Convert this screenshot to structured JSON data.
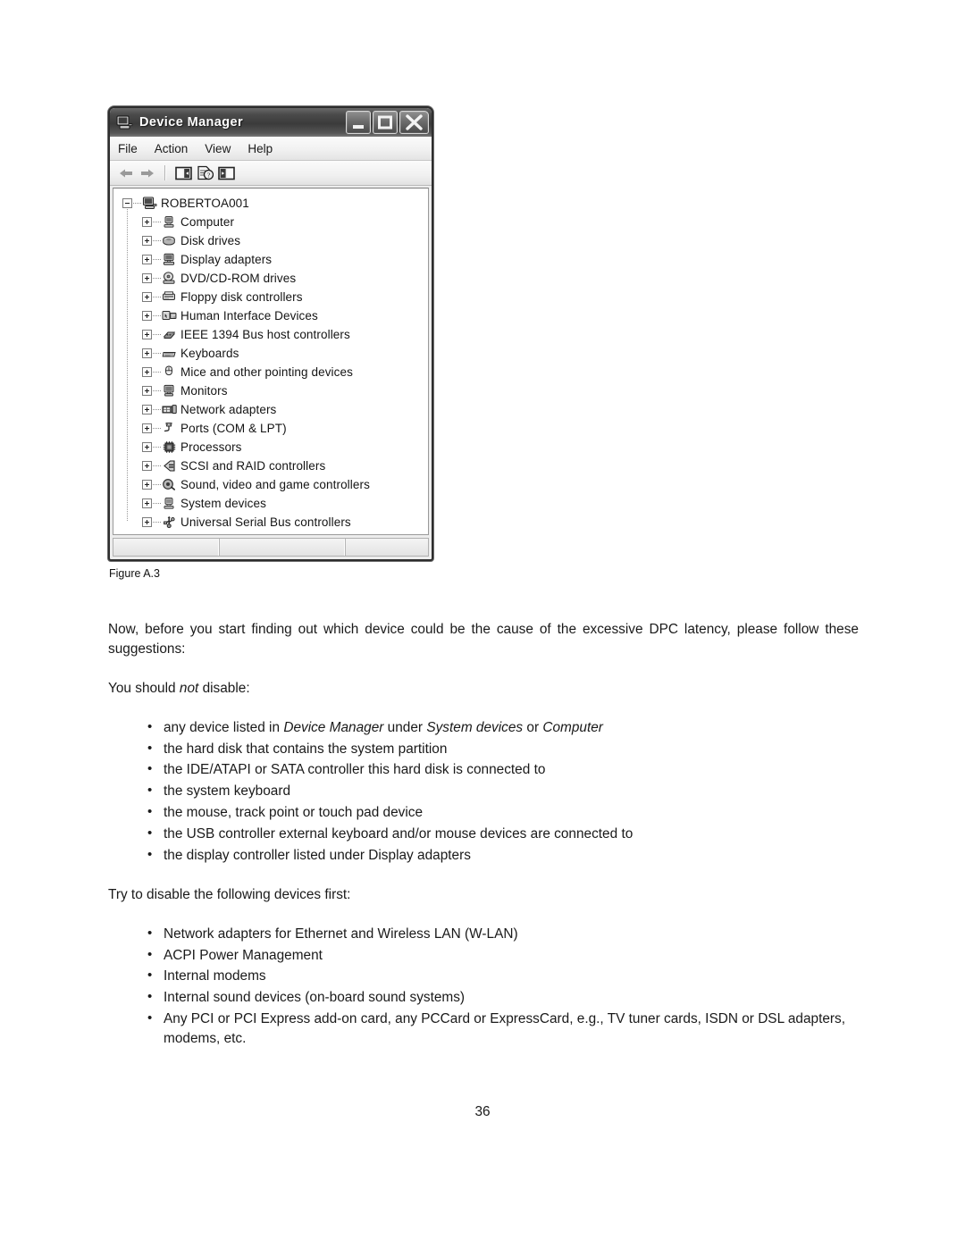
{
  "figure": {
    "caption": "Figure A.3",
    "window": {
      "title": "Device Manager",
      "title_icon": "computer-icon",
      "window_buttons": [
        {
          "name": "minimize-button",
          "glyph": "minimize-icon"
        },
        {
          "name": "maximize-button",
          "glyph": "maximize-icon"
        },
        {
          "name": "close-button",
          "glyph": "close-icon"
        }
      ],
      "menu": [
        "File",
        "Action",
        "View",
        "Help"
      ],
      "toolbar": [
        {
          "name": "back-button",
          "icon": "arrow-left-icon"
        },
        {
          "name": "forward-button",
          "icon": "arrow-right-icon"
        },
        {
          "name": "separator",
          "icon": "separator"
        },
        {
          "name": "show-hide-console-tree-button",
          "icon": "console-tree-icon"
        },
        {
          "name": "properties-button",
          "icon": "properties-icon"
        },
        {
          "name": "scan-for-hardware-changes-button",
          "icon": "panel-icon"
        }
      ],
      "tree": {
        "root": {
          "label": "ROBERTOA001",
          "icon": "computer-node-icon",
          "state": "expanded"
        },
        "children": [
          {
            "label": "Computer",
            "icon": "computer-category-icon",
            "state": "collapsed"
          },
          {
            "label": "Disk drives",
            "icon": "disk-drive-icon",
            "state": "collapsed"
          },
          {
            "label": "Display adapters",
            "icon": "display-adapter-icon",
            "state": "collapsed"
          },
          {
            "label": "DVD/CD-ROM drives",
            "icon": "optical-drive-icon",
            "state": "collapsed"
          },
          {
            "label": "Floppy disk controllers",
            "icon": "floppy-controller-icon",
            "state": "collapsed"
          },
          {
            "label": "Human Interface Devices",
            "icon": "hid-icon",
            "state": "collapsed"
          },
          {
            "label": "IEEE 1394 Bus host controllers",
            "icon": "firewire-icon",
            "state": "collapsed"
          },
          {
            "label": "Keyboards",
            "icon": "keyboard-icon",
            "state": "collapsed"
          },
          {
            "label": "Mice and other pointing devices",
            "icon": "mouse-icon",
            "state": "collapsed"
          },
          {
            "label": "Monitors",
            "icon": "monitor-icon",
            "state": "collapsed"
          },
          {
            "label": "Network adapters",
            "icon": "network-adapter-icon",
            "state": "collapsed"
          },
          {
            "label": "Ports (COM & LPT)",
            "icon": "port-icon",
            "state": "collapsed"
          },
          {
            "label": "Processors",
            "icon": "processor-icon",
            "state": "collapsed"
          },
          {
            "label": "SCSI and RAID controllers",
            "icon": "scsi-raid-icon",
            "state": "collapsed"
          },
          {
            "label": "Sound, video and game controllers",
            "icon": "sound-icon",
            "state": "collapsed"
          },
          {
            "label": "System devices",
            "icon": "system-device-icon",
            "state": "collapsed"
          },
          {
            "label": "Universal Serial Bus controllers",
            "icon": "usb-icon",
            "state": "collapsed"
          }
        ]
      },
      "status_panels": [
        "",
        "",
        ""
      ]
    }
  },
  "body": {
    "intro_paragraph": "Now, before you start finding out which device could be the cause of the excessive DPC latency, please follow these suggestions:",
    "not_disable_lead_before": "You should ",
    "not_disable_lead_italic": "not",
    "not_disable_lead_after": " disable:",
    "do_not_disable_list": [
      {
        "parts": [
          {
            "text": "any device listed in ",
            "italic": false
          },
          {
            "text": "Device Manager",
            "italic": true
          },
          {
            "text": " under ",
            "italic": false
          },
          {
            "text": "System devices",
            "italic": true
          },
          {
            "text": " or ",
            "italic": false
          },
          {
            "text": "Computer",
            "italic": true
          }
        ]
      },
      {
        "parts": [
          {
            "text": "the hard disk that contains the system partition",
            "italic": false
          }
        ]
      },
      {
        "parts": [
          {
            "text": "the IDE/ATAPI or SATA controller this hard disk is connected to",
            "italic": false
          }
        ]
      },
      {
        "parts": [
          {
            "text": "the system keyboard",
            "italic": false
          }
        ]
      },
      {
        "parts": [
          {
            "text": "the mouse, track point or touch pad device",
            "italic": false
          }
        ]
      },
      {
        "parts": [
          {
            "text": "the USB controller external keyboard and/or mouse devices are connected to",
            "italic": false
          }
        ]
      },
      {
        "parts": [
          {
            "text": "the display controller listed under Display adapters",
            "italic": false
          }
        ]
      }
    ],
    "disable_first_lead": "Try to disable the following devices first:",
    "disable_first_list": [
      "Network adapters for Ethernet and Wireless LAN (W-LAN)",
      "ACPI Power Management",
      "Internal modems",
      "Internal sound devices (on-board sound systems)",
      "Any PCI or PCI Express add-on card, any PCCard or ExpressCard, e.g., TV tuner cards, ISDN or DSL adapters, modems, etc."
    ]
  },
  "page_number": "36"
}
